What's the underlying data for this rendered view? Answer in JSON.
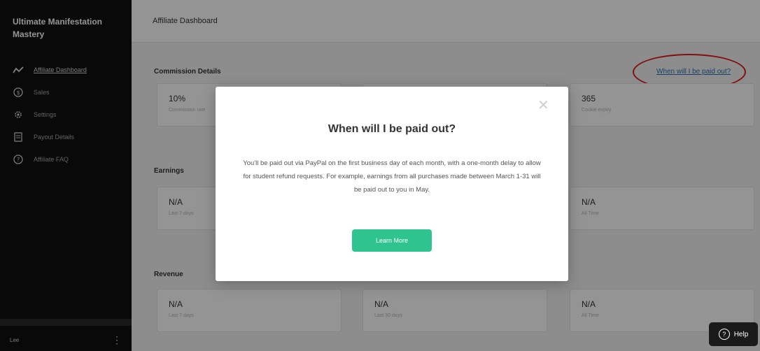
{
  "sidebar": {
    "brand": "Ultimate Manifestation Mastery",
    "items": [
      {
        "label": "Affiliate Dashboard",
        "icon": "trend-line-icon"
      },
      {
        "label": "Sales",
        "icon": "dollar-circle-icon"
      },
      {
        "label": "Settings",
        "icon": "gear-icon"
      },
      {
        "label": "Payout Details",
        "icon": "document-icon"
      },
      {
        "label": "Affiliate FAQ",
        "icon": "question-circle-icon"
      }
    ],
    "user_name": "Lee"
  },
  "header": {
    "title": "Affiliate Dashboard"
  },
  "main": {
    "commission_title": "Commission Details",
    "payout_link": "When will I be paid out?",
    "commission_cards": [
      {
        "value": "10%",
        "label": "Commission rate"
      },
      {
        "value": "365",
        "label": "Cookie expiry"
      }
    ],
    "earnings_title": "Earnings",
    "earnings_cards": [
      {
        "value": "N/A",
        "label": "Last 7 days"
      },
      {
        "value": "N/A",
        "label": "All Time"
      }
    ],
    "revenue_title": "Revenue",
    "revenue_cards": [
      {
        "value": "N/A",
        "label": "Last 7 days"
      },
      {
        "value": "N/A",
        "label": "Last 30 days"
      },
      {
        "value": "N/A",
        "label": "All Time"
      }
    ]
  },
  "modal": {
    "close_symbol": "✕",
    "heading": "When will I be paid out?",
    "body": "You'll be paid out via PayPal on the first business day of each month, with a one-month delay to allow for student refund requests. For example, earnings from all purchases made between March 1-31 will be paid out to you in May.",
    "button_label": "Learn More"
  },
  "help": {
    "label": "Help"
  },
  "colors": {
    "accent": "#2ec38f",
    "annotation": "#e21b1b",
    "link": "#2f6fb3"
  }
}
